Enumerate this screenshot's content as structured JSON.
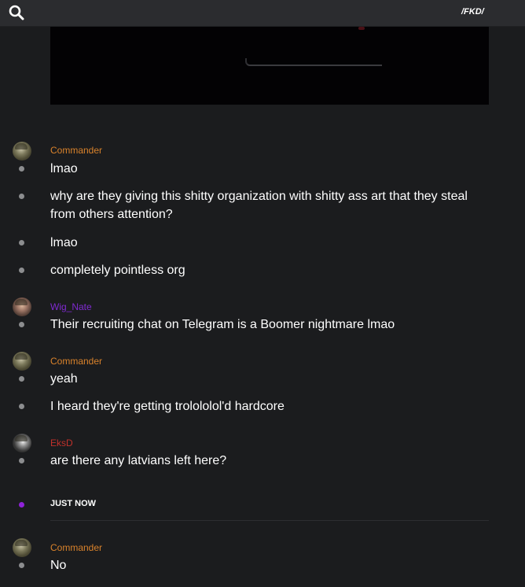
{
  "header": {
    "channel": "/FKD/",
    "search_icon": "search-icon"
  },
  "colors": {
    "background": "#1b1c1e",
    "commander": "#d9822b",
    "wig_nate": "#7f2ad0",
    "eksd": "#c0312b",
    "new_marker": "#8f22d9"
  },
  "messages": [
    {
      "user": "Commander",
      "lines": [
        "lmao",
        "why are they giving this shitty organization with shitty ass art that they steal from others attention?",
        "lmao",
        "completely pointless org"
      ]
    },
    {
      "user": "Wig_Nate",
      "lines": [
        "Their recruiting chat on Telegram is a Boomer nightmare lmao"
      ]
    },
    {
      "user": "Commander",
      "lines": [
        "yeah",
        "I heard they're getting trolololol'd hardcore"
      ]
    },
    {
      "user": "EksD",
      "lines": [
        "are there any latvians left here?"
      ]
    }
  ],
  "separator": {
    "label": "JUST NOW"
  },
  "new_messages": [
    {
      "user": "Commander",
      "lines": [
        "No"
      ]
    }
  ]
}
